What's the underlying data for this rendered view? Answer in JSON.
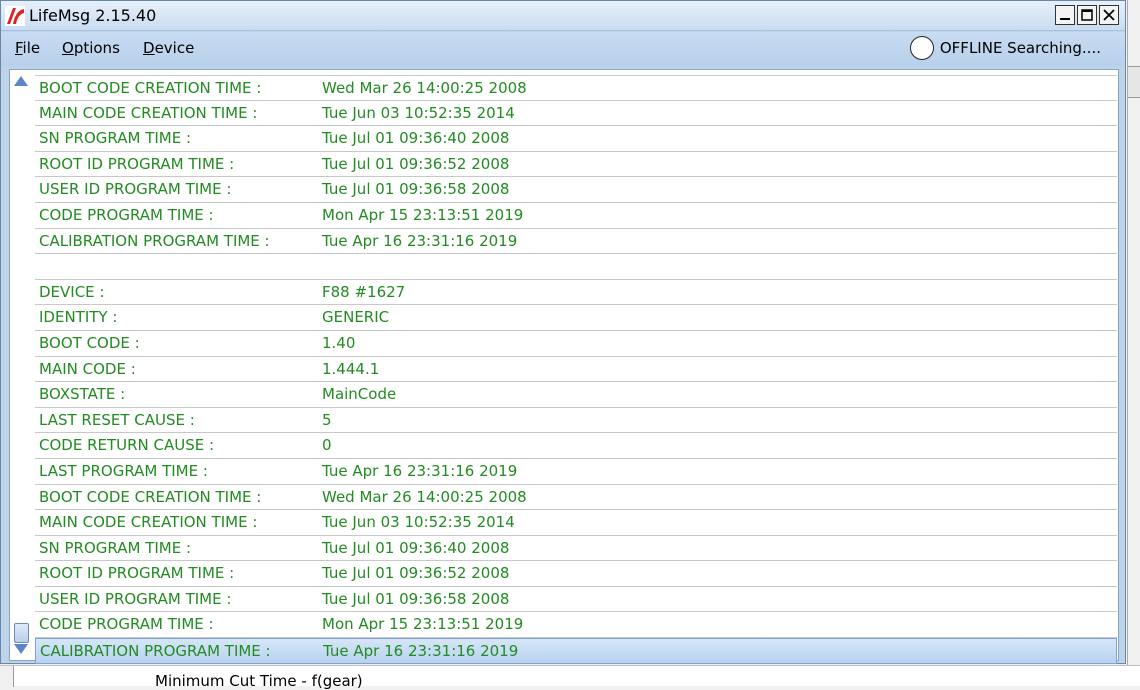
{
  "window": {
    "title": "LifeMsg 2.15.40"
  },
  "menu": {
    "file": {
      "first": "F",
      "rest": "ile"
    },
    "options": {
      "first": "O",
      "rest": "ptions"
    },
    "device": {
      "first": "D",
      "rest": "evice"
    }
  },
  "status": {
    "text": "OFFLINE Searching...."
  },
  "rows": [
    {
      "label": "BOOT CODE CREATION TIME :",
      "value": "Wed Mar 26 14:00:25 2008"
    },
    {
      "label": "MAIN CODE CREATION TIME :",
      "value": "Tue Jun 03 10:52:35 2014"
    },
    {
      "label": "SN PROGRAM TIME :",
      "value": "Tue Jul 01 09:36:40 2008"
    },
    {
      "label": "ROOT ID PROGRAM TIME :",
      "value": "Tue Jul 01 09:36:52 2008"
    },
    {
      "label": "USER ID PROGRAM TIME :",
      "value": "Tue Jul 01 09:36:58 2008"
    },
    {
      "label": "CODE PROGRAM TIME :",
      "value": "Mon Apr 15 23:13:51 2019"
    },
    {
      "label": "CALIBRATION PROGRAM TIME :",
      "value": "Tue Apr 16 23:31:16 2019"
    },
    {
      "label": "",
      "value": ""
    },
    {
      "label": "DEVICE :",
      "value": "F88 #1627"
    },
    {
      "label": "IDENTITY :",
      "value": "GENERIC"
    },
    {
      "label": "BOOT CODE :",
      "value": "1.40"
    },
    {
      "label": "MAIN CODE :",
      "value": "1.444.1"
    },
    {
      "label": "BOXSTATE :",
      "value": "MainCode"
    },
    {
      "label": "LAST RESET CAUSE :",
      "value": "5"
    },
    {
      "label": "CODE RETURN CAUSE :",
      "value": "0"
    },
    {
      "label": "LAST PROGRAM TIME :",
      "value": "Tue Apr 16 23:31:16 2019"
    },
    {
      "label": "BOOT CODE CREATION TIME :",
      "value": "Wed Mar 26 14:00:25 2008"
    },
    {
      "label": "MAIN CODE CREATION TIME :",
      "value": "Tue Jun 03 10:52:35 2014"
    },
    {
      "label": "SN PROGRAM TIME :",
      "value": "Tue Jul 01 09:36:40 2008"
    },
    {
      "label": "ROOT ID PROGRAM TIME :",
      "value": "Tue Jul 01 09:36:52 2008"
    },
    {
      "label": "USER ID PROGRAM TIME :",
      "value": "Tue Jul 01 09:36:58 2008"
    },
    {
      "label": "CODE PROGRAM TIME :",
      "value": "Mon Apr 15 23:13:51 2019"
    },
    {
      "label": "CALIBRATION PROGRAM TIME :",
      "value": "Tue Apr 16 23:31:16 2019"
    }
  ],
  "background": {
    "partial_text": "Minimum Cut Time - f(gear)"
  },
  "colors": {
    "row_text": "#228b22",
    "selected_row": "#b8d2f0"
  }
}
